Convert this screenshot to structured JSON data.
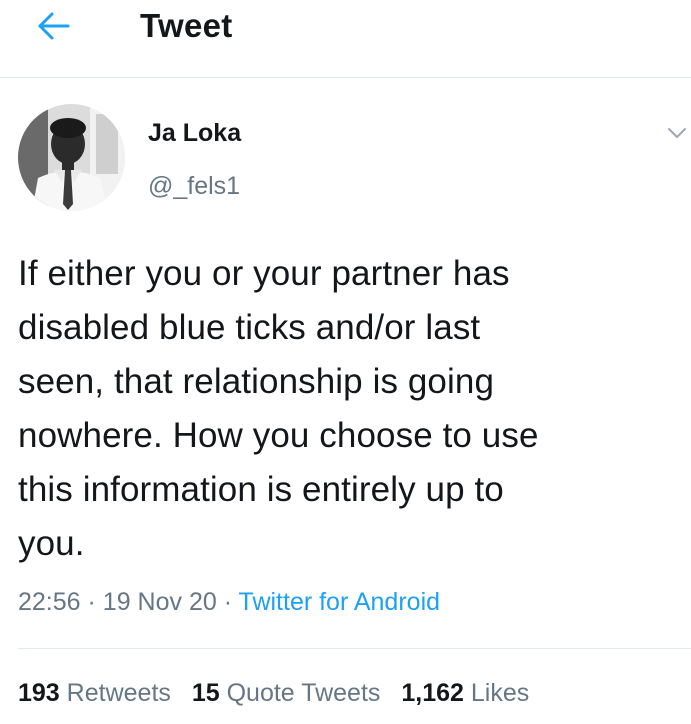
{
  "header": {
    "back_icon": "arrow-left-icon",
    "title": "Tweet"
  },
  "tweet": {
    "author": {
      "name": "Ja Loka",
      "handle": "@_fels1",
      "avatar": "profile-photo"
    },
    "menu_icon": "chevron-down-icon",
    "text": "If either you or your partner has\ndisabled blue ticks and/or last\nseen, that relationship is going\nnowhere. How you choose to use\nthis information is entirely up to\nyou.",
    "time": "22:56",
    "date": "19 Nov 20",
    "separator": "·",
    "source": "Twitter for Android"
  },
  "stats": {
    "retweets": {
      "count": "193",
      "label": "Retweets"
    },
    "quote_tweets": {
      "count": "15",
      "label": "Quote Tweets"
    },
    "likes": {
      "count": "1,162",
      "label": "Likes"
    }
  },
  "colors": {
    "accent": "#1da1f2",
    "secondary_text": "#657786",
    "primary_text": "#14171a",
    "divider": "#e1e8ed"
  }
}
